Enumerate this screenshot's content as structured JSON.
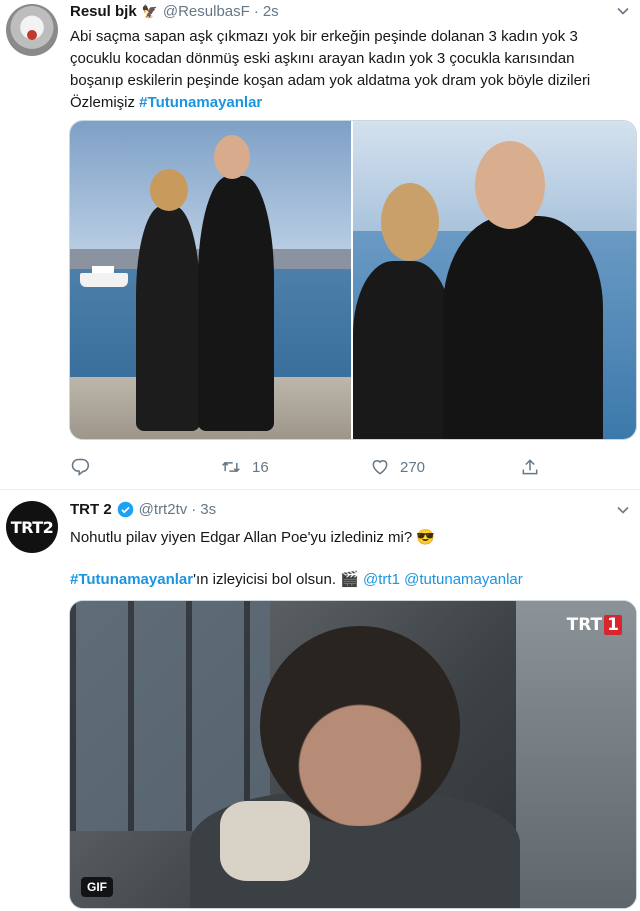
{
  "tweets": [
    {
      "author_name": "Resul bjk",
      "handle": "@ResulbasF",
      "separator": "·",
      "time": "2s",
      "text": "Abi saçma sapan aşk çıkmazı yok bir erkeğin peşinde dolanan 3 kadın yok 3 çocuklu kocadan dönmüş eski aşkını arayan kadın yok 3 çocukla karısından boşanıp eskilerin peşinde koşan adam yok aldatma yok dram yok böyle dizileri Özlemişiz ",
      "hashtag": "#Tutunamayanlar",
      "photos": [
        "photo-1",
        "photo-2"
      ],
      "replies": "",
      "retweets": "16",
      "likes": "270"
    },
    {
      "author_name": "TRT 2",
      "handle": "@trt2tv",
      "separator": "·",
      "time": "3s",
      "verified": true,
      "avatar_text": "TRT2",
      "line1": "Nohutlu pilav yiyen Edgar Allan Poe'yu izlediniz mi? 😎",
      "line2_hashtag": "#Tutunamayanlar",
      "line2_text": "'ın izleyicisi bol olsun. 🎬 ",
      "mention1": "@trt1",
      "mention2": "@tutunamayanlar",
      "gif_label": "GIF",
      "gif_channel_logo": "TRT",
      "gif_channel_num": "1"
    }
  ],
  "icons": {
    "reply": "reply-icon",
    "retweet": "retweet-icon",
    "like": "heart-icon",
    "share": "share-icon",
    "more": "chevron-down-icon",
    "verified": "verified-badge-icon"
  },
  "colors": {
    "link": "#1b95e0",
    "muted": "#657786",
    "text": "#14171a"
  }
}
